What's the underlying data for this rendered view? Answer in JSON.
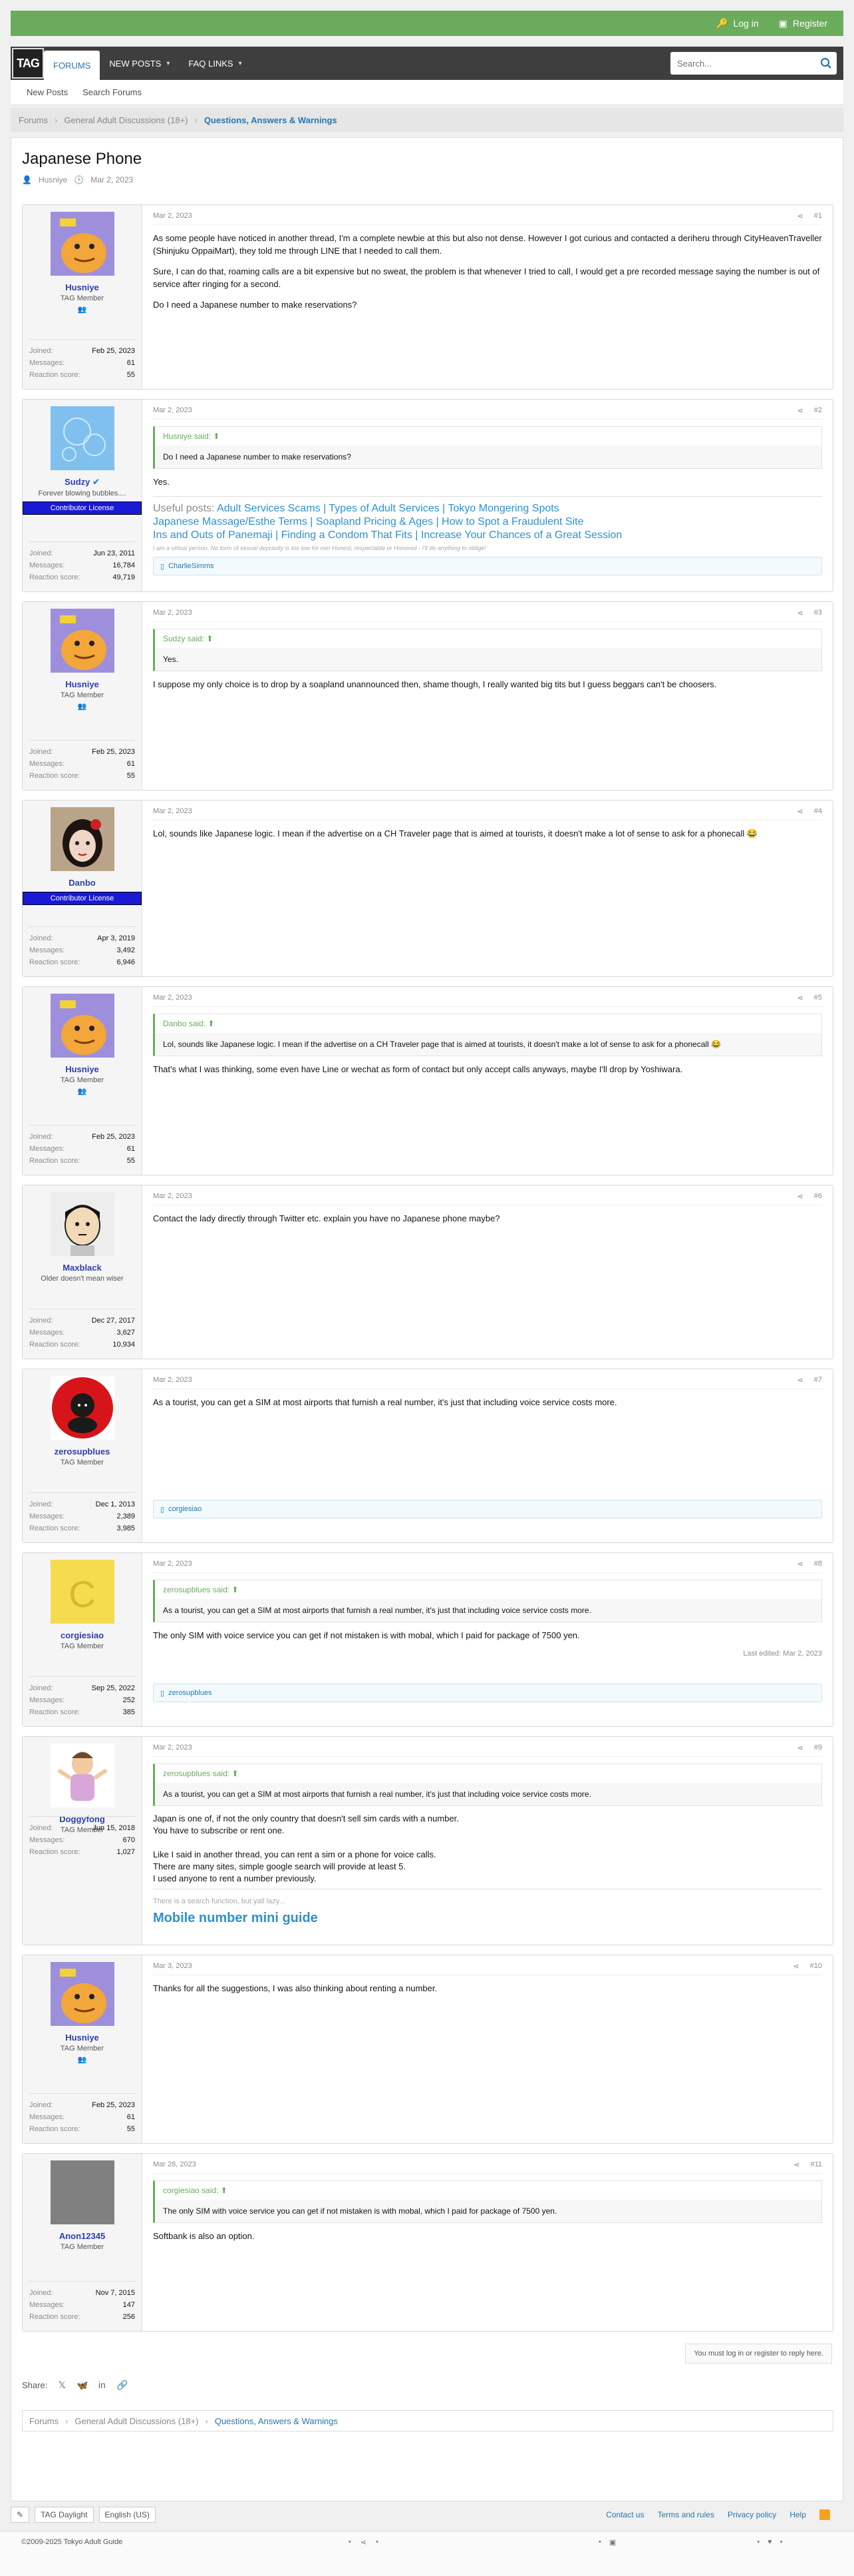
{
  "topbar": {
    "login": "Log in",
    "register": "Register"
  },
  "nav": {
    "logo": "TAG",
    "tabs": [
      "Forums",
      "New posts",
      "FAQ Links"
    ],
    "search_placeholder": "Search...",
    "sub": [
      "New Posts",
      "Search Forums"
    ]
  },
  "breadcrumb": [
    "Forums",
    "General Adult Discussions (18+)",
    "Questions, Answers & Warnings"
  ],
  "thread": {
    "title": "Japanese Phone",
    "author": "Husniye",
    "date": "Mar 2, 2023"
  },
  "labels": {
    "joined": "Joined:",
    "messages": "Messages:",
    "reaction": "Reaction score:",
    "said": "said:"
  },
  "users": {
    "husniye": {
      "name": "Husniye",
      "title": "TAG Member",
      "joined": "Feb 25, 2023",
      "messages": "61",
      "reaction": "55"
    },
    "sudzy": {
      "name": "Sudzy",
      "title": "Forever blowing bubbles....",
      "banner": "Contributor License",
      "joined": "Jun 23, 2011",
      "messages": "16,784",
      "reaction": "49,719"
    },
    "danbo": {
      "name": "Danbo",
      "banner": "Contributor License",
      "joined": "Apr 3, 2019",
      "messages": "3,492",
      "reaction": "6,946"
    },
    "maxblack": {
      "name": "Maxblack",
      "title": "Older doesn't mean wiser",
      "joined": "Dec 27, 2017",
      "messages": "3,627",
      "reaction": "10,934"
    },
    "zerosupblues": {
      "name": "zerosupblues",
      "title": "TAG Member",
      "joined": "Dec 1, 2013",
      "messages": "2,389",
      "reaction": "3,985"
    },
    "corgiesiao": {
      "name": "corgiesiao",
      "title": "TAG Member",
      "initial": "C",
      "joined": "Sep 25, 2022",
      "messages": "252",
      "reaction": "385"
    },
    "doggyfong": {
      "name": "Doggyfong",
      "title": "TAG Member",
      "joined": "Jun 15, 2018",
      "messages": "670",
      "reaction": "1,027"
    },
    "anon": {
      "name": "Anon12345",
      "title": "TAG Member",
      "joined": "Nov 7, 2015",
      "messages": "147",
      "reaction": "256"
    }
  },
  "posts": {
    "p1": {
      "date": "Mar 2, 2023",
      "num": "#1",
      "para1": "As some people have noticed in another thread, I'm a complete newbie at this but also not dense. However I got curious and contacted a deriheru through CityHeavenTraveller (Shinjuku OppaiMart), they told me through LINE that I needed to call them.",
      "para2": "Sure, I can do that, roaming calls are a bit expensive but no sweat, the problem is that whenever I tried to call, I would get a pre recorded message saying the number is out of service after ringing for a second.",
      "para3": "Do I need a Japanese number to make reservations?"
    },
    "p2": {
      "date": "Mar 2, 2023",
      "num": "#2",
      "quote_author": "Husniye",
      "quote": "Do I need a Japanese number to make reservations?",
      "text": "Yes.",
      "sig_label": "Useful posts: ",
      "sig1": "Adult Services Scams | Types of Adult Services | Tokyo Mongering Spots",
      "sig2": "Japanese Massage/Esthe Terms | Soapland Pricing & Ages | How to Spot a Fraudulent Site",
      "sig3": "Ins and Outs of Panemaji | Finding a Condom That Fits | Increase Your Chances of a Great Session",
      "sig_small": "I am a virtual person. No form of sexual depravity is too low for me! Honest, respectable or Honored - I'll do anything to oblige!",
      "react": "CharlieSimms"
    },
    "p3": {
      "date": "Mar 2, 2023",
      "num": "#3",
      "quote_author": "Sudzy",
      "quote": "Yes.",
      "text": "I suppose my only choice is to drop by a soapland unannounced then, shame though, I really wanted big tits but I guess beggars can't be choosers."
    },
    "p4": {
      "date": "Mar 2, 2023",
      "num": "#4",
      "text": "Lol, sounds like Japanese logic. I mean if the advertise on a CH Traveler page that is aimed at tourists, it doesn't make a lot of sense to ask for a phonecall 😂"
    },
    "p5": {
      "date": "Mar 2, 2023",
      "num": "#5",
      "quote_author": "Danbo",
      "quote": "Lol, sounds like Japanese logic. I mean if the advertise on a CH Traveler page that is aimed at tourists, it doesn't make a lot of sense to ask for a phonecall 😂",
      "text": "That's what I was thinking, some even have Line or wechat as form of contact but only accept calls anyways, maybe I'll drop by Yoshiwara."
    },
    "p6": {
      "date": "Mar 2, 2023",
      "num": "#6",
      "text": "Contact the lady directly through Twitter etc. explain you have no Japanese phone maybe?"
    },
    "p7": {
      "date": "Mar 2, 2023",
      "num": "#7",
      "text": "As a tourist, you can get a SIM at most airports that furnish a real number, it's just that including voice service costs more.",
      "react": "corgiesiao"
    },
    "p8": {
      "date": "Mar 2, 2023",
      "num": "#8",
      "quote_author": "zerosupblues",
      "quote": "As a tourist, you can get a SIM at most airports that furnish a real number, it's just that including voice service costs more.",
      "text": "The only SIM with voice service you can get if not mistaken is with mobal, which I paid for package of 7500 yen.",
      "edited": "Last edited: Mar 2, 2023",
      "react": "zerosupblues"
    },
    "p9": {
      "date": "Mar 2, 2023",
      "num": "#9",
      "quote_author": "zerosupblues",
      "quote": "As a tourist, you can get a SIM at most airports that furnish a real number, it's just that including voice service costs more.",
      "line1": "Japan is one of, if not the only country that doesn't sell sim cards with a number.",
      "line2": "You have to subscribe or rent one.",
      "line3": "Like I said in another thread, you can rent a sim or a phone for voice calls.",
      "line4": "There are many sites, simple google search will provide at least 5.",
      "line5": "I used anyone to rent a number previously.",
      "hint": "There is a search function, but yall lazy...",
      "guide": "Mobile number mini guide"
    },
    "p10": {
      "date": "Mar 3, 2023",
      "num": "#10",
      "text": "Thanks for all the suggestions, I was also thinking about renting a number."
    },
    "p11": {
      "date": "Mar 28, 2023",
      "num": "#11",
      "quote_author": "corgiesiao",
      "quote": "The only SIM with voice service you can get if not mistaken is with mobal, which I paid for package of 7500 yen.",
      "text": "Softbank is also an option."
    }
  },
  "login_required": "You must log in or register to reply here.",
  "share_label": "Share:",
  "footer": {
    "style": "TAG Daylight",
    "lang": "English (US)",
    "links": [
      "Contact us",
      "Terms and rules",
      "Privacy policy",
      "Help"
    ],
    "copyright": "©2009-2025 Tokyo Adult Guide"
  },
  "colors": {
    "accent_green": "#6aac5c",
    "nav_dark": "#3e3e3e",
    "link_blue": "#2577b1",
    "username_blue": "#2e3fb0",
    "contributor_blue": "#1a1ad6"
  }
}
